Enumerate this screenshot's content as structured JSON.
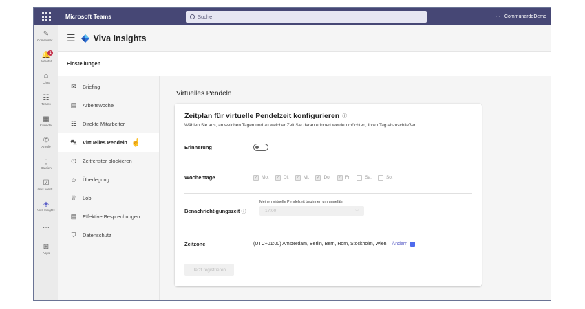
{
  "topbar": {
    "app_name": "Microsoft Teams",
    "search_placeholder": "Suche",
    "more": "···",
    "tenant": "CommunardoDemo"
  },
  "rail": [
    {
      "label": "Communar...",
      "icon": "org-icon",
      "glyph": "✎"
    },
    {
      "label": "Aktivität",
      "icon": "bell-icon",
      "glyph": "🔔",
      "badge": "1"
    },
    {
      "label": "Chat",
      "icon": "chat-icon",
      "glyph": "☺"
    },
    {
      "label": "Teams",
      "icon": "teams-icon",
      "glyph": "☷"
    },
    {
      "label": "Kalender",
      "icon": "calendar-icon",
      "glyph": "▦"
    },
    {
      "label": "Anrufe",
      "icon": "phone-icon",
      "glyph": "✆"
    },
    {
      "label": "Dateien",
      "icon": "file-icon",
      "glyph": "▯"
    },
    {
      "label": "asks von P...",
      "icon": "tasks-icon",
      "glyph": "☑"
    },
    {
      "label": "Viva Insights",
      "icon": "viva-icon",
      "glyph": "◈",
      "active": true
    },
    {
      "label": "",
      "icon": "more-icon",
      "glyph": "···"
    },
    {
      "label": "Apps",
      "icon": "apps-icon",
      "glyph": "⊞"
    }
  ],
  "header": {
    "title": "Viva Insights"
  },
  "settings_title": "Einstellungen",
  "nav": [
    {
      "label": "Briefing",
      "icon": "mail-icon",
      "glyph": "✉"
    },
    {
      "label": "Arbeitswoche",
      "icon": "calendar-icon",
      "glyph": "▤"
    },
    {
      "label": "Direkte Mitarbeiter",
      "icon": "people-icon",
      "glyph": "☷"
    },
    {
      "label": "Virtuelles Pendeln",
      "icon": "car-icon",
      "glyph": "⛍",
      "active": true
    },
    {
      "label": "Zeitfenster blockieren",
      "icon": "clock-icon",
      "glyph": "◷"
    },
    {
      "label": "Überlegung",
      "icon": "smile-icon",
      "glyph": "☺"
    },
    {
      "label": "Lob",
      "icon": "ribbon-icon",
      "glyph": "♕"
    },
    {
      "label": "Effektive Besprechungen",
      "icon": "meeting-icon",
      "glyph": "▤"
    },
    {
      "label": "Datenschutz",
      "icon": "shield-icon",
      "glyph": "⛉"
    }
  ],
  "main": {
    "page_title": "Virtuelles Pendeln",
    "card_title": "Zeitplan für virtuelle Pendelzeit konfigurieren",
    "card_subtitle": "Wählen Sie aus, an welchen Tagen und zu welcher Zeit Sie daran erinnert werden möchten, Ihren Tag abzuschließen.",
    "reminder_label": "Erinnerung",
    "reminder_on": false,
    "weekdays_label": "Wochentage",
    "days": [
      {
        "label": "Mo.",
        "checked": true
      },
      {
        "label": "Di.",
        "checked": true
      },
      {
        "label": "Mi.",
        "checked": true
      },
      {
        "label": "Do.",
        "checked": true
      },
      {
        "label": "Fr.",
        "checked": true
      },
      {
        "label": "Sa.",
        "checked": false
      },
      {
        "label": "So.",
        "checked": false
      }
    ],
    "notification_label": "Benachrichtigungszeit",
    "notification_caption": "Meinen virtuelle Pendelzeit beginnen um ungefähr",
    "notification_time": "17:00",
    "timezone_label": "Zeitzone",
    "timezone_value": "(UTC+01:00) Amsterdam, Berlin, Bern, Rom, Stockholm, Wien",
    "timezone_change": "Ändern",
    "register_button": "Jetzt registrieren"
  }
}
